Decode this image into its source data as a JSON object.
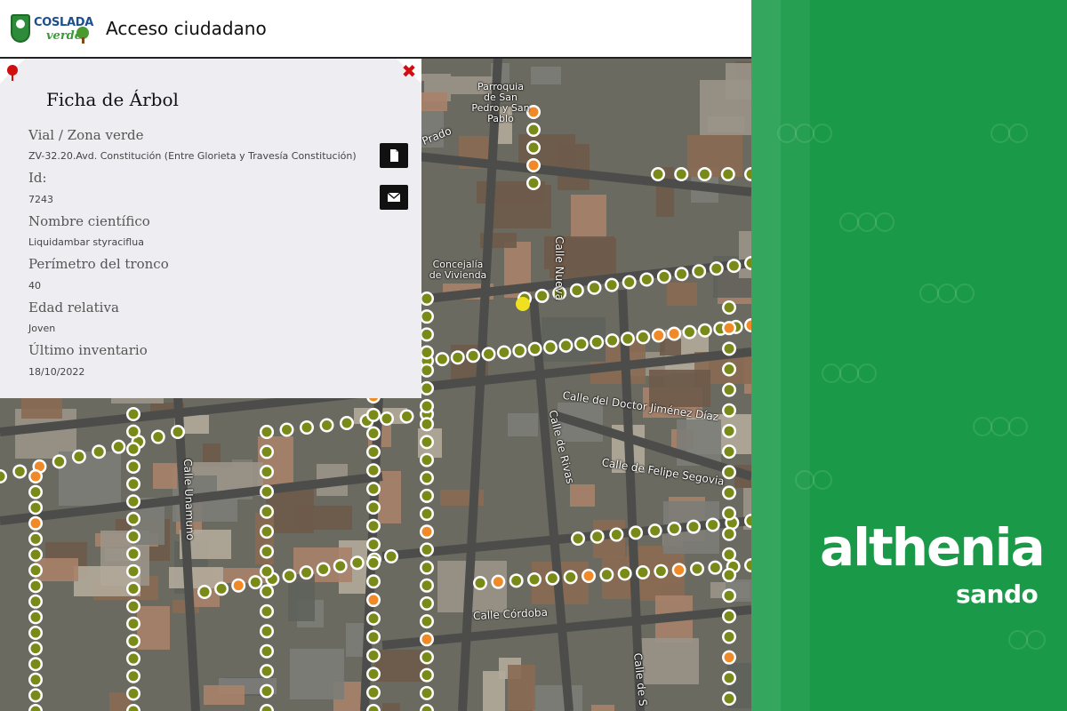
{
  "header": {
    "logo_line1": "COSLADA",
    "logo_line2": "verde",
    "title": "Acceso ciudadano"
  },
  "card": {
    "title": "Ficha de Árbol",
    "fields": [
      {
        "label": "Vial / Zona verde",
        "value": "ZV-32.20.Avd. Constitución (Entre Glorieta y Travesía Constitución)"
      },
      {
        "label": "Id:",
        "value": "7243"
      },
      {
        "label": "Nombre científico",
        "value": "Liquidambar styraciflua"
      },
      {
        "label": "Perímetro del tronco",
        "value": "40"
      },
      {
        "label": "Edad relativa",
        "value": "Joven"
      },
      {
        "label": "Último inventario",
        "value": "18/10/2022"
      }
    ],
    "icons": {
      "tree": "tree-icon",
      "close": "close-icon",
      "document": "document-icon",
      "mail": "mail-icon"
    },
    "colors": {
      "close": "#d01010",
      "tree": "#d01010"
    }
  },
  "map": {
    "streets": [
      "Prado",
      "Calle Nueva",
      "Calle del Doctor Jiménez Díaz",
      "Calle de Rivas",
      "Calle de Felipe Segovia",
      "Calle Unamuno",
      "Calle Córdoba",
      "Calle de S"
    ],
    "pois": [
      "Parroquia de San Pedro y San Pablo",
      "Concejalía de Vivienda"
    ],
    "marker_colors": {
      "tree": "#7a8a18",
      "highlight": "#f08a28",
      "selected": "#f0e020",
      "ring": "#ffffff"
    }
  },
  "brand": {
    "name": "althenia",
    "sub": "sando",
    "color": "#1a9a48"
  }
}
